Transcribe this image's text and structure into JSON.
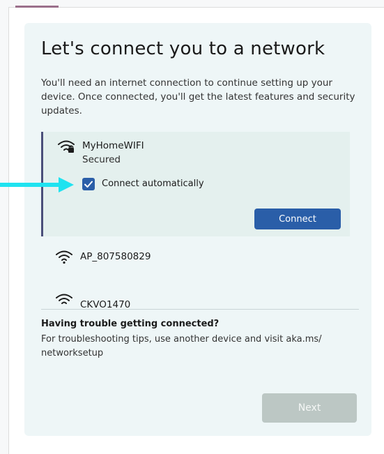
{
  "page": {
    "title": "Let's connect you to a network",
    "description": "You'll need an internet connection to continue setting up your device. Once connected, you'll get the latest features and security updates."
  },
  "networks": [
    {
      "name": "MyHomeWIFI",
      "status": "Secured",
      "secured": true,
      "selected": true
    },
    {
      "name": "AP_807580829",
      "status": "",
      "secured": false,
      "selected": false
    },
    {
      "name": "CKVO1470",
      "status": "",
      "secured": false,
      "selected": false
    }
  ],
  "selected_network": {
    "connect_automatically_label": "Connect automatically",
    "connect_automatically_checked": true,
    "connect_button_label": "Connect"
  },
  "help": {
    "title": "Having trouble getting connected?",
    "text": "For troubleshooting tips, use another device and visit aka.ms/ networksetup"
  },
  "footer": {
    "next_button_label": "Next",
    "next_button_enabled": false
  },
  "icons": {
    "wifi": "wifi-icon",
    "lock": "lock-icon",
    "check": "checkmark-icon",
    "scroll_up": "scroll-up-arrow-icon",
    "scroll_down": "scroll-down-arrow-icon",
    "annotation": "pointer-arrow-icon"
  },
  "colors": {
    "accent": "#2a5ea8",
    "card_background": "#eef6f7",
    "selected_background": "#e4f0ee",
    "disabled_button": "#bcc7c4",
    "annotation_arrow": "#1fe3f0"
  }
}
